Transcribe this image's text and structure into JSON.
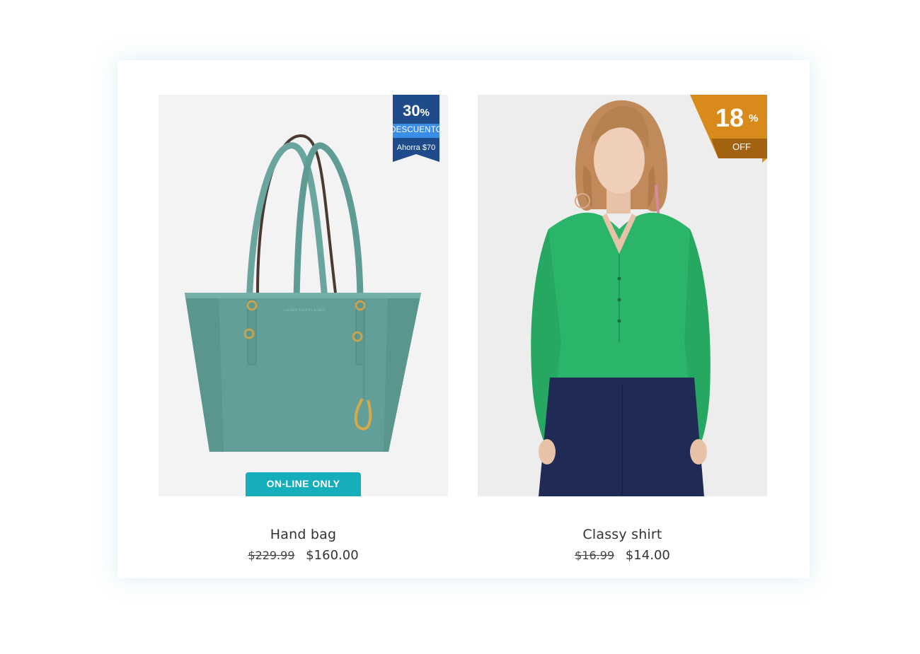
{
  "products": [
    {
      "name": "Hand bag",
      "old_price": "$229.99",
      "new_price": "$160.00",
      "image": "teal-tote-bag",
      "badge": {
        "style": "ribbon",
        "percent": "30",
        "percent_symbol": "%",
        "label": "DESCUENTO",
        "saving": "Ahorra $70",
        "color": "#1f4b8a",
        "band_color": "#3a8ee6"
      },
      "tag": {
        "label": "ON-LINE ONLY",
        "color": "#17aebc"
      }
    },
    {
      "name": "Classy shirt",
      "old_price": "$16.99",
      "new_price": "$14.00",
      "image": "woman-green-blouse",
      "badge": {
        "style": "corner",
        "percent": "18",
        "percent_symbol": "%",
        "label": "OFF",
        "color": "#d88a1a",
        "dark_color": "#a2620f"
      }
    }
  ]
}
